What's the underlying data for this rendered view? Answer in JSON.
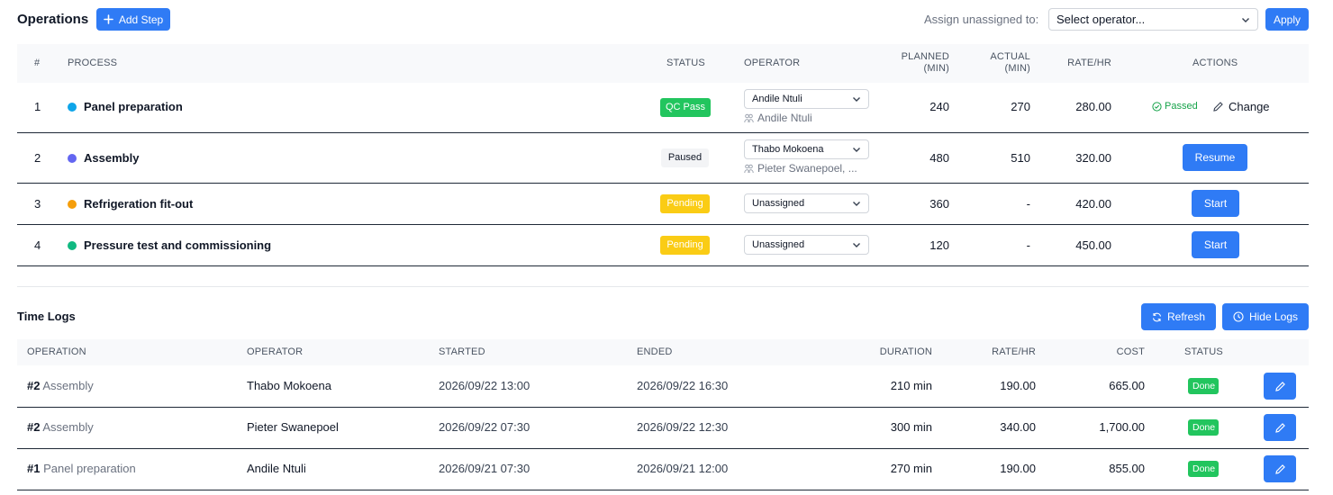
{
  "operations": {
    "title": "Operations",
    "add_step_label": "Add Step",
    "assign_label": "Assign unassigned to:",
    "assign_select_value": "Select operator...",
    "apply_label": "Apply",
    "headers": {
      "num": "#",
      "process": "PROCESS",
      "status": "STATUS",
      "operator": "OPERATOR",
      "planned_1": "PLANNED",
      "planned_2": "(MIN)",
      "actual_1": "ACTUAL",
      "actual_2": "(MIN)",
      "rate": "RATE/HR",
      "actions": "ACTIONS"
    },
    "rows": [
      {
        "num": "1",
        "process": "Panel preparation",
        "dot_color": "#0ea5e9",
        "status": "QC Pass",
        "operator": "Andile Ntuli",
        "assigned": "Andile Ntuli",
        "planned": "240",
        "actual": "270",
        "rate": "280.00",
        "passed_label": "Passed",
        "change_label": "Change"
      },
      {
        "num": "2",
        "process": "Assembly",
        "dot_color": "#6366f1",
        "status": "Paused",
        "operator": "Thabo Mokoena",
        "assigned": "Pieter Swanepoel, ...",
        "planned": "480",
        "actual": "510",
        "rate": "320.00",
        "action_label": "Resume"
      },
      {
        "num": "3",
        "process": "Refrigeration fit-out",
        "dot_color": "#f59e0b",
        "status": "Pending",
        "operator": "Unassigned",
        "planned": "360",
        "actual": "-",
        "rate": "420.00",
        "action_label": "Start"
      },
      {
        "num": "4",
        "process": "Pressure test and commissioning",
        "dot_color": "#10b981",
        "status": "Pending",
        "operator": "Unassigned",
        "planned": "120",
        "actual": "-",
        "rate": "450.00",
        "action_label": "Start"
      }
    ]
  },
  "time_logs": {
    "title": "Time Logs",
    "refresh_label": "Refresh",
    "hide_logs_label": "Hide Logs",
    "headers": {
      "operation": "OPERATION",
      "operator": "OPERATOR",
      "started": "STARTED",
      "ended": "ENDED",
      "duration": "DURATION",
      "rate": "RATE/HR",
      "cost": "COST",
      "status": "STATUS"
    },
    "rows": [
      {
        "op_num": "#2",
        "op_name": "Assembly",
        "operator": "Thabo Mokoena",
        "started": "2026/09/22 13:00",
        "ended": "2026/09/22 16:30",
        "duration": "210 min",
        "rate": "190.00",
        "cost": "665.00",
        "status": "Done"
      },
      {
        "op_num": "#2",
        "op_name": "Assembly",
        "operator": "Pieter Swanepoel",
        "started": "2026/09/22 07:30",
        "ended": "2026/09/22 12:30",
        "duration": "300 min",
        "rate": "340.00",
        "cost": "1,700.00",
        "status": "Done"
      },
      {
        "op_num": "#1",
        "op_name": "Panel preparation",
        "operator": "Andile Ntuli",
        "started": "2026/09/21 07:30",
        "ended": "2026/09/21 12:00",
        "duration": "270 min",
        "rate": "190.00",
        "cost": "855.00",
        "status": "Done"
      }
    ]
  },
  "colors": {
    "primary": "#2f7bf5",
    "success": "#22c55e",
    "warning": "#facc15"
  }
}
